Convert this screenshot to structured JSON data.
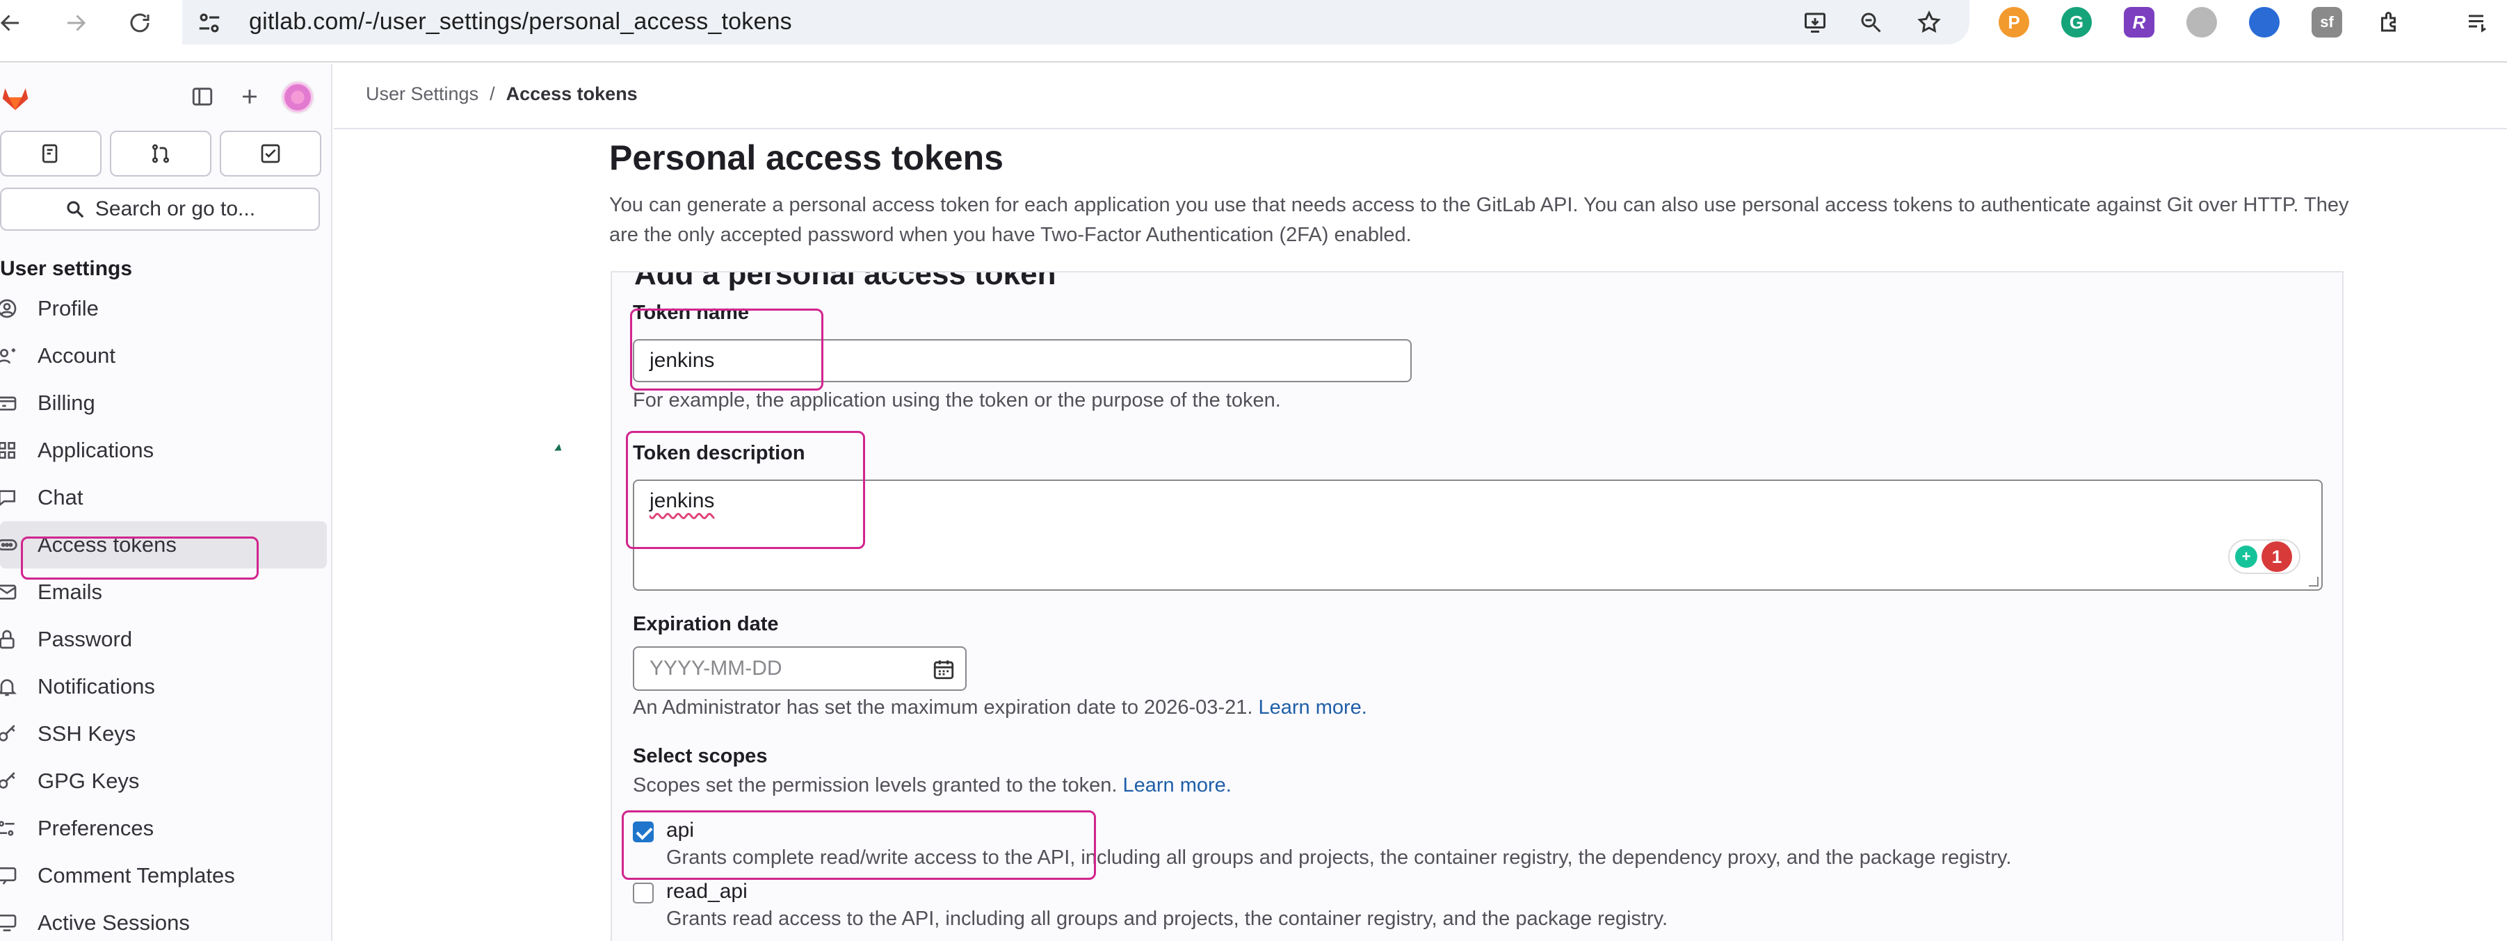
{
  "browser": {
    "url": "gitlab.com/-/user_settings/personal_access_tokens",
    "icons": [
      "back-icon",
      "forward-icon",
      "reload-icon",
      "site-info-icon",
      "install-icon",
      "zoom-icon",
      "bookmark-star-icon",
      "extensions-icon",
      "reading-list-icon"
    ],
    "extensions": [
      {
        "name": "extension-orange-p",
        "glyph": "P",
        "color": "#f29a2e"
      },
      {
        "name": "extension-grammarly",
        "glyph": "G",
        "color": "#15a37a"
      },
      {
        "name": "extension-purple-r",
        "glyph": "R",
        "color": "#7b3fbf"
      },
      {
        "name": "extension-elephant",
        "glyph": "",
        "color": "#9a9a9a"
      },
      {
        "name": "extension-blue-dots",
        "glyph": "",
        "color": "#2a6bd6"
      },
      {
        "name": "extension-sql",
        "glyph": "sf",
        "color": "#8a8a8a"
      }
    ]
  },
  "sidebar": {
    "search_label": "Search or go to...",
    "heading": "User settings",
    "items": [
      {
        "label": "Profile",
        "icon": "profile-icon",
        "active": false
      },
      {
        "label": "Account",
        "icon": "account-icon",
        "active": false
      },
      {
        "label": "Billing",
        "icon": "billing-icon",
        "active": false
      },
      {
        "label": "Applications",
        "icon": "applications-icon",
        "active": false
      },
      {
        "label": "Chat",
        "icon": "chat-icon",
        "active": false
      },
      {
        "label": "Access tokens",
        "icon": "token-icon",
        "active": true
      },
      {
        "label": "Emails",
        "icon": "email-icon",
        "active": false
      },
      {
        "label": "Password",
        "icon": "lock-icon",
        "active": false
      },
      {
        "label": "Notifications",
        "icon": "bell-icon",
        "active": false
      },
      {
        "label": "SSH Keys",
        "icon": "key-icon",
        "active": false
      },
      {
        "label": "GPG Keys",
        "icon": "key-icon",
        "active": false
      },
      {
        "label": "Preferences",
        "icon": "preferences-icon",
        "active": false
      },
      {
        "label": "Comment Templates",
        "icon": "comment-icon",
        "active": false
      },
      {
        "label": "Active Sessions",
        "icon": "sessions-icon",
        "active": false
      }
    ]
  },
  "breadcrumb": {
    "items": [
      "User Settings",
      "Access tokens"
    ],
    "separator": "/"
  },
  "main": {
    "title": "Personal access tokens",
    "intro": "You can generate a personal access token for each application you use that needs access to the GitLab API. You can also use personal access tokens to authenticate against Git over HTTP. They are the only accepted password when you have Two-Factor Authentication (2FA) enabled.",
    "form_heading": "Add a personal access token",
    "token_name": {
      "label": "Token name",
      "value": "jenkins",
      "help": "For example, the application using the token or the purpose of the token."
    },
    "token_description": {
      "label": "Token description",
      "value": "jenkins",
      "grammarly_count": "1"
    },
    "expiration": {
      "label": "Expiration date",
      "placeholder": "YYYY-MM-DD",
      "help": "An Administrator has set the maximum expiration date to 2026-03-21.",
      "link": "Learn more."
    },
    "scopes": {
      "label": "Select scopes",
      "help": "Scopes set the permission levels granted to the token.",
      "link": "Learn more.",
      "items": [
        {
          "name": "api",
          "checked": true,
          "description": "Grants complete read/write access to the API, including all groups and projects, the container registry, the dependency proxy, and the package registry."
        },
        {
          "name": "read_api",
          "checked": false,
          "description": "Grants read access to the API, including all groups and projects, the container registry, and the package registry."
        }
      ]
    }
  },
  "colors": {
    "highlight": "#d1258e",
    "link": "#1f5fa8",
    "checkbox_checked": "#1f75cb"
  }
}
